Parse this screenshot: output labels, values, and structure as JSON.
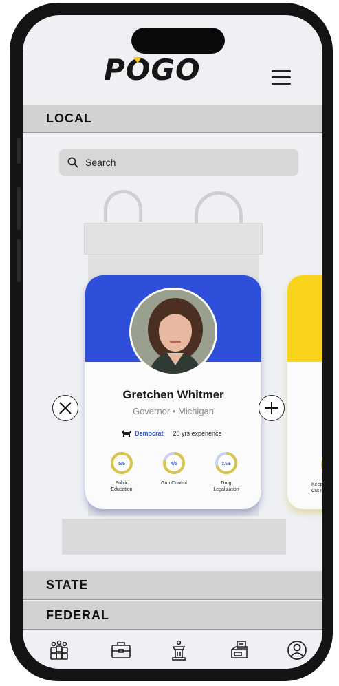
{
  "app": {
    "logo_text": "POGO"
  },
  "sections": {
    "local_label": "LOCAL",
    "state_label": "STATE",
    "federal_label": "FEDERAL"
  },
  "search": {
    "placeholder": "Search"
  },
  "candidate": {
    "name": "Gretchen Whitmer",
    "role": "Governor",
    "separator": "•",
    "location": "Michigan",
    "party": "Democrat",
    "experience": "20 yrs experience",
    "ratings": [
      {
        "score": "5/5",
        "value": 5,
        "label_line1": "Public",
        "label_line2": "Education"
      },
      {
        "score": "4/5",
        "value": 4,
        "label_line1": "Gun Control",
        "label_line2": ""
      },
      {
        "score": "3.5/5",
        "value": 3.5,
        "label_line1": "Drug",
        "label_line2": "Legalization"
      }
    ],
    "header_color": "#2f4ed9"
  },
  "next_candidate": {
    "header_color": "#f7d31c",
    "label_line1": "Keep",
    "label_line2": "Cut I"
  },
  "icons": {
    "menu": "hamburger-menu-icon",
    "search": "search-icon",
    "reject": "close-icon",
    "add": "plus-icon",
    "nav": [
      "people-icon",
      "briefcase-icon",
      "podium-icon",
      "ballot-box-icon",
      "profile-icon"
    ]
  },
  "colors": {
    "accent": "#2f4ed9",
    "rating_ring": "#d8c44a",
    "rating_bg": "#f1e9a7"
  }
}
